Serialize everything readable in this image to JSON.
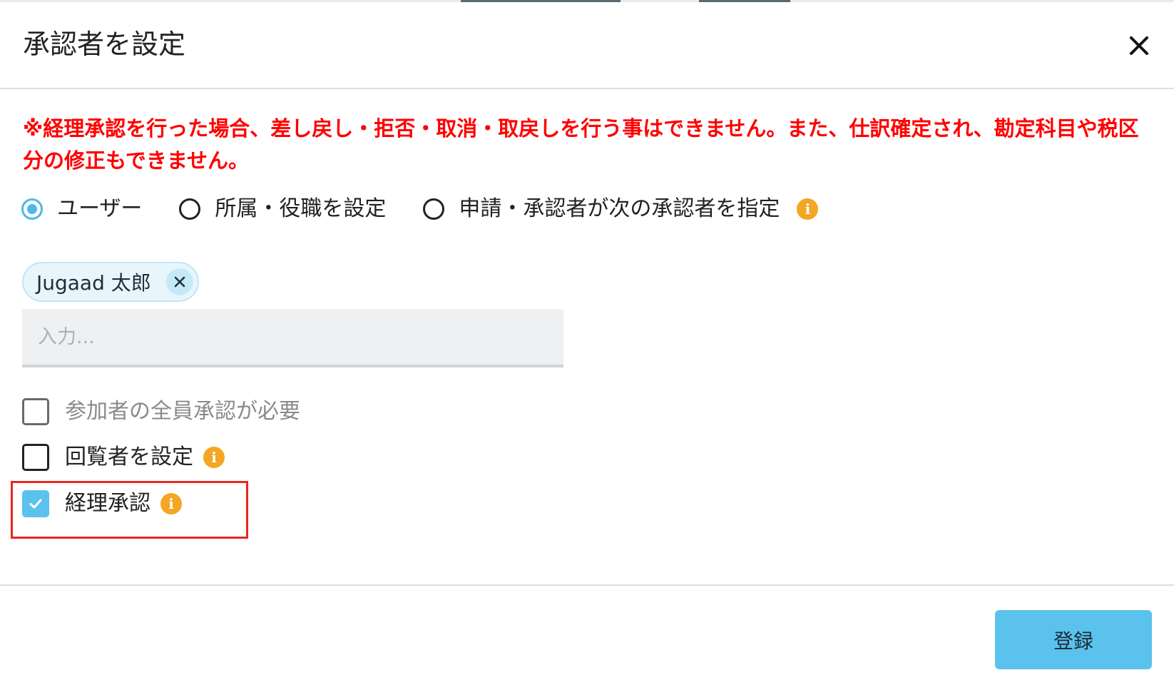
{
  "dialog": {
    "title": "承認者を設定",
    "close_icon": "close-icon",
    "warning": "※経理承認を行った場合、差し戻し・拒否・取消・取戻しを行う事はできません。また、仕訳確定され、勘定科目や税区分の修正もできません。"
  },
  "radios": [
    {
      "label": "ユーザー",
      "selected": true
    },
    {
      "label": "所属・役職を設定",
      "selected": false
    },
    {
      "label": "申請・承認者が次の承認者を指定",
      "selected": false
    }
  ],
  "info_icon": {
    "glyph": "i",
    "color": "#f5a623"
  },
  "selected_user": {
    "name": "Jugaad 太郎",
    "remove_icon": "close-icon"
  },
  "search": {
    "placeholder": "入力...",
    "value": ""
  },
  "checkboxes": [
    {
      "label": "参加者の全員承認が必要",
      "checked": false,
      "disabled": true
    },
    {
      "label": "回覧者を設定",
      "checked": false,
      "disabled": false
    },
    {
      "label": "経理承認",
      "checked": true,
      "disabled": false
    }
  ],
  "footer": {
    "submit_label": "登録"
  },
  "colors": {
    "accent": "#5bc2ee",
    "warning": "#ff0000",
    "info": "#f5a623",
    "highlight": "#e8281e"
  }
}
